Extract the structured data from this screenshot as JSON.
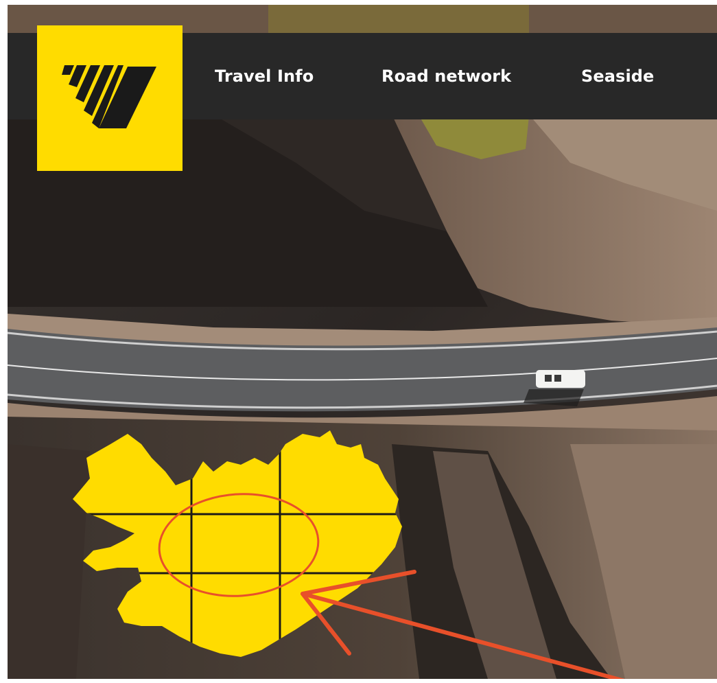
{
  "brand": {
    "logo_icon": "stripe-v-logo-icon",
    "logo_color": "#ffdc00",
    "logo_mark_color": "#1a1a1a"
  },
  "nav": {
    "background": "#282828",
    "items": [
      {
        "label": "Travel Info"
      },
      {
        "label": "Road network"
      },
      {
        "label": "Seaside"
      }
    ]
  },
  "hero": {
    "map_icon": "iceland-map-icon",
    "map_color": "#ffdc00",
    "annotation_color": "#e8502a",
    "annotation_icons": [
      "circle-annotation-icon",
      "arrow-annotation-icon"
    ]
  }
}
